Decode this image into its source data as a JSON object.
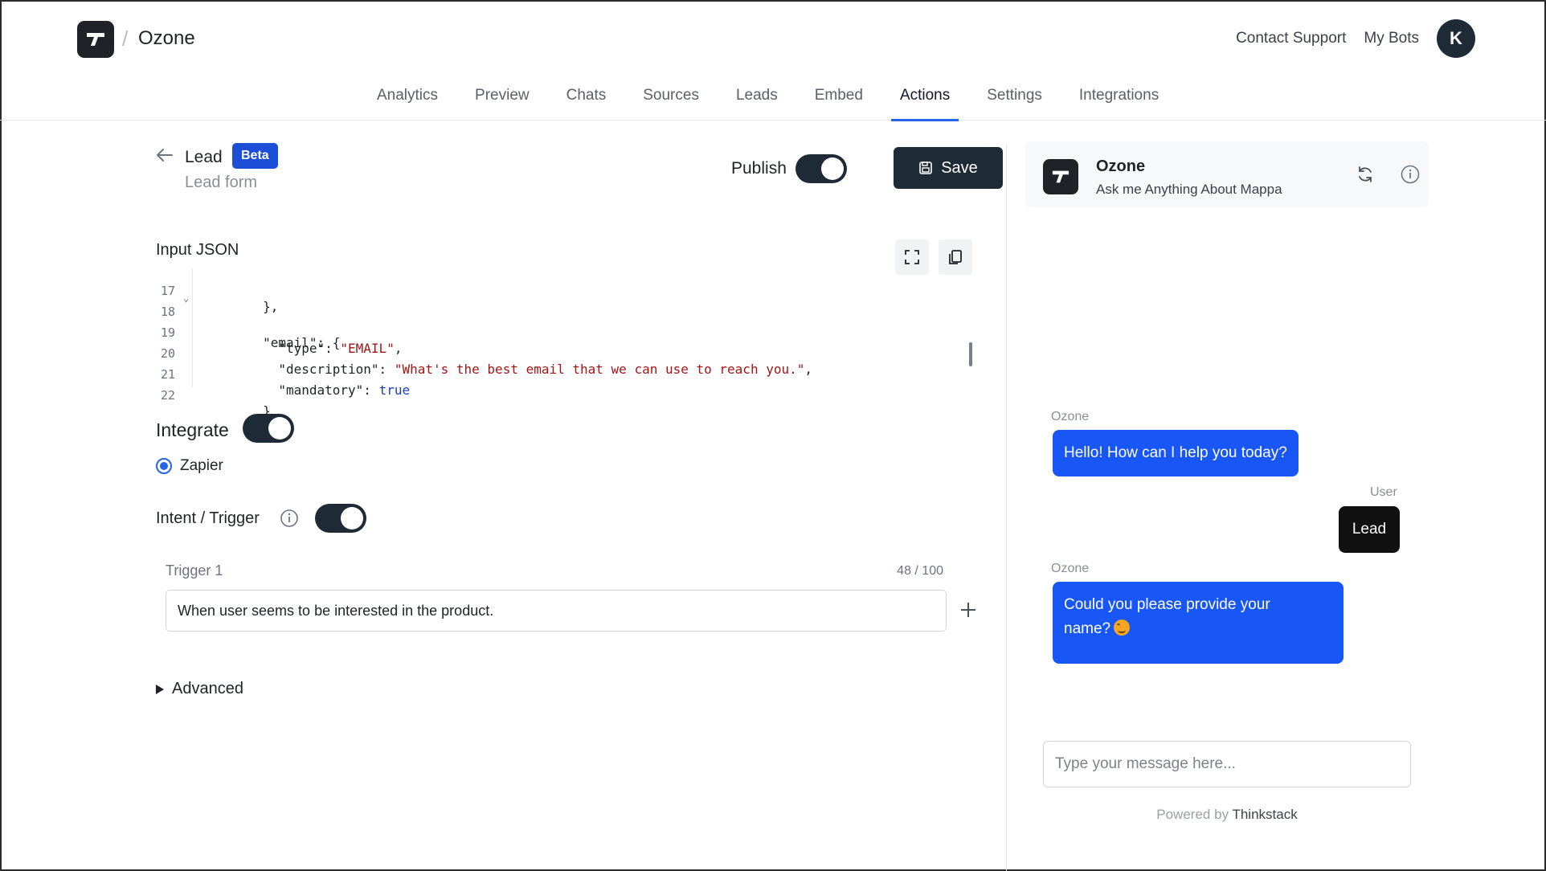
{
  "header": {
    "brand": "Ozone",
    "separator": "/",
    "contact_support": "Contact Support",
    "my_bots": "My Bots",
    "avatar_initial": "K"
  },
  "tabs": [
    {
      "label": "Analytics",
      "active": false
    },
    {
      "label": "Preview",
      "active": false
    },
    {
      "label": "Chats",
      "active": false
    },
    {
      "label": "Sources",
      "active": false
    },
    {
      "label": "Leads",
      "active": false
    },
    {
      "label": "Embed",
      "active": false
    },
    {
      "label": "Actions",
      "active": true
    },
    {
      "label": "Settings",
      "active": false
    },
    {
      "label": "Integrations",
      "active": false
    }
  ],
  "editor": {
    "title": "Lead",
    "badge": "Beta",
    "subtitle": "Lead form",
    "publish_label": "Publish",
    "publish_on": true,
    "save_label": "Save",
    "input_json_label": "Input JSON",
    "code_lines": [
      {
        "num": "17",
        "text": "        },"
      },
      {
        "num": "18",
        "text": "        \"email\": {",
        "foldable": true
      },
      {
        "num": "19",
        "text": "          \"type\": ",
        "string": "\"EMAIL\"",
        "after": ","
      },
      {
        "num": "20",
        "text": "          \"description\": ",
        "string": "\"What's the best email that we can use to reach you.\"",
        "after": ","
      },
      {
        "num": "21",
        "text": "          \"mandatory\": ",
        "bool": "true"
      },
      {
        "num": "22",
        "text": "        }"
      }
    ],
    "integrate_label": "Integrate",
    "integrate_on": true,
    "integration_option": "Zapier",
    "intent_label": "Intent / Trigger",
    "intent_on": true,
    "trigger_label": "Trigger 1",
    "trigger_count": "48 / 100",
    "trigger_value": "When user seems to be interested in the product.",
    "advanced_label": "Advanced"
  },
  "preview": {
    "bot_name": "Ozone",
    "bot_tagline": "Ask me Anything About Mappa",
    "messages": [
      {
        "sender": "Ozone",
        "text": "Hello! How can I help you today?",
        "role": "bot"
      },
      {
        "sender": "User",
        "text": "Lead",
        "role": "user"
      },
      {
        "sender": "Ozone",
        "text_line1": "Could you please provide your",
        "text_line2": "name?",
        "role": "bot"
      }
    ],
    "input_placeholder": "Type your message here...",
    "powered_by": "Powered by",
    "powered_brand": "Thinkstack"
  },
  "colors": {
    "accent": "#2563eb",
    "bot_bubble": "#1856f6",
    "dark": "#1f2a37"
  }
}
